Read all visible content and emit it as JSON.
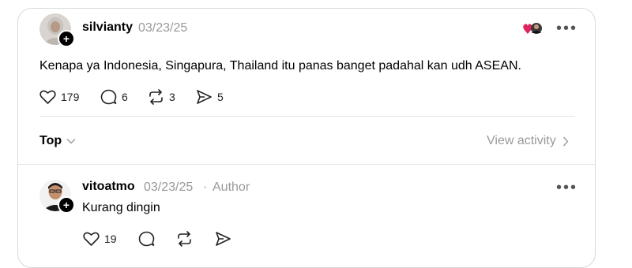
{
  "post": {
    "username": "silvianty",
    "date": "03/23/25",
    "text": "Kenapa ya Indonesia, Singapura, Thailand itu panas banget padahal kan udh ASEAN.",
    "likes": "179",
    "replies": "6",
    "reposts": "3",
    "shares": "5",
    "more_label": "•••"
  },
  "filter": {
    "sort_label": "Top",
    "view_activity_label": "View activity"
  },
  "reply": {
    "username": "vitoatmo",
    "date": "03/23/25",
    "separator": "·",
    "role": "Author",
    "text": "Kurang dingin",
    "likes": "19",
    "more_label": "•••"
  },
  "colors": {
    "heart_accent": "#e0245e",
    "muted_text": "#999999",
    "divider": "#e5e5e5"
  },
  "icons": [
    "heart-icon",
    "comment-icon",
    "repost-icon",
    "share-icon",
    "chevron-down-icon",
    "chevron-right-icon",
    "more-icon",
    "follow-plus-icon"
  ]
}
